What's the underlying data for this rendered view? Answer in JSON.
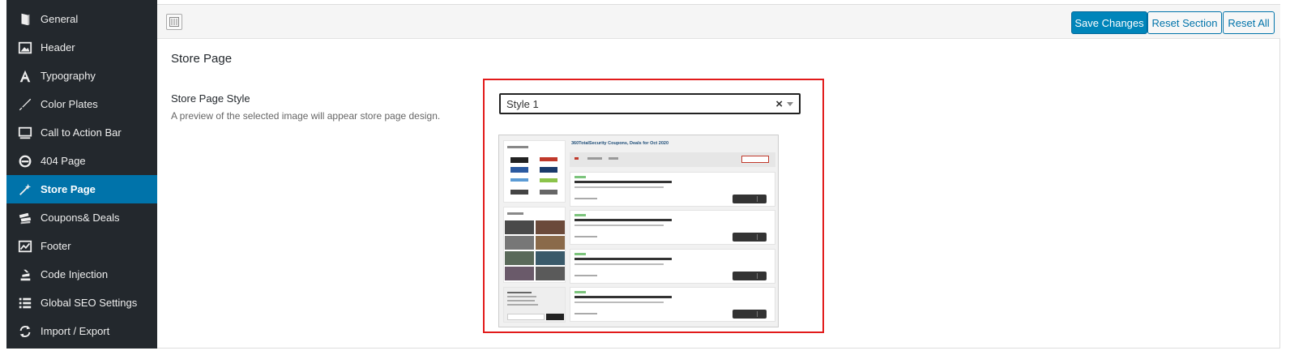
{
  "sidebar": {
    "items": [
      {
        "label": "General",
        "icon": "book-icon"
      },
      {
        "label": "Header",
        "icon": "image-icon"
      },
      {
        "label": "Typography",
        "icon": "typography-icon"
      },
      {
        "label": "Color Plates",
        "icon": "brush-icon"
      },
      {
        "label": "Call to Action Bar",
        "icon": "monitor-icon"
      },
      {
        "label": "404 Page",
        "icon": "no-entry-icon"
      },
      {
        "label": "Store Page",
        "icon": "magic-wand-icon",
        "active": true
      },
      {
        "label": "Coupons& Deals",
        "icon": "tickets-icon"
      },
      {
        "label": "Footer",
        "icon": "chart-icon"
      },
      {
        "label": "Code Injection",
        "icon": "stack-icon"
      },
      {
        "label": "Global SEO Settings",
        "icon": "list-icon"
      },
      {
        "label": "Import / Export",
        "icon": "refresh-icon"
      }
    ]
  },
  "toolbar": {
    "save_label": "Save Changes",
    "reset_section_label": "Reset Section",
    "reset_all_label": "Reset All"
  },
  "section": {
    "title": "Store Page"
  },
  "field": {
    "label": "Store Page Style",
    "description": "A preview of the selected image will appear store page design.",
    "selected_value": "Style 1",
    "clear_glyph": "×"
  },
  "preview": {
    "title": "360TotalSecurity Coupons, Deals for Oct 2020"
  },
  "colors": {
    "sidebar_bg": "#23282d",
    "active_bg": "#0073aa",
    "primary_button": "#0085ba",
    "highlight_border": "#e21b1b"
  }
}
